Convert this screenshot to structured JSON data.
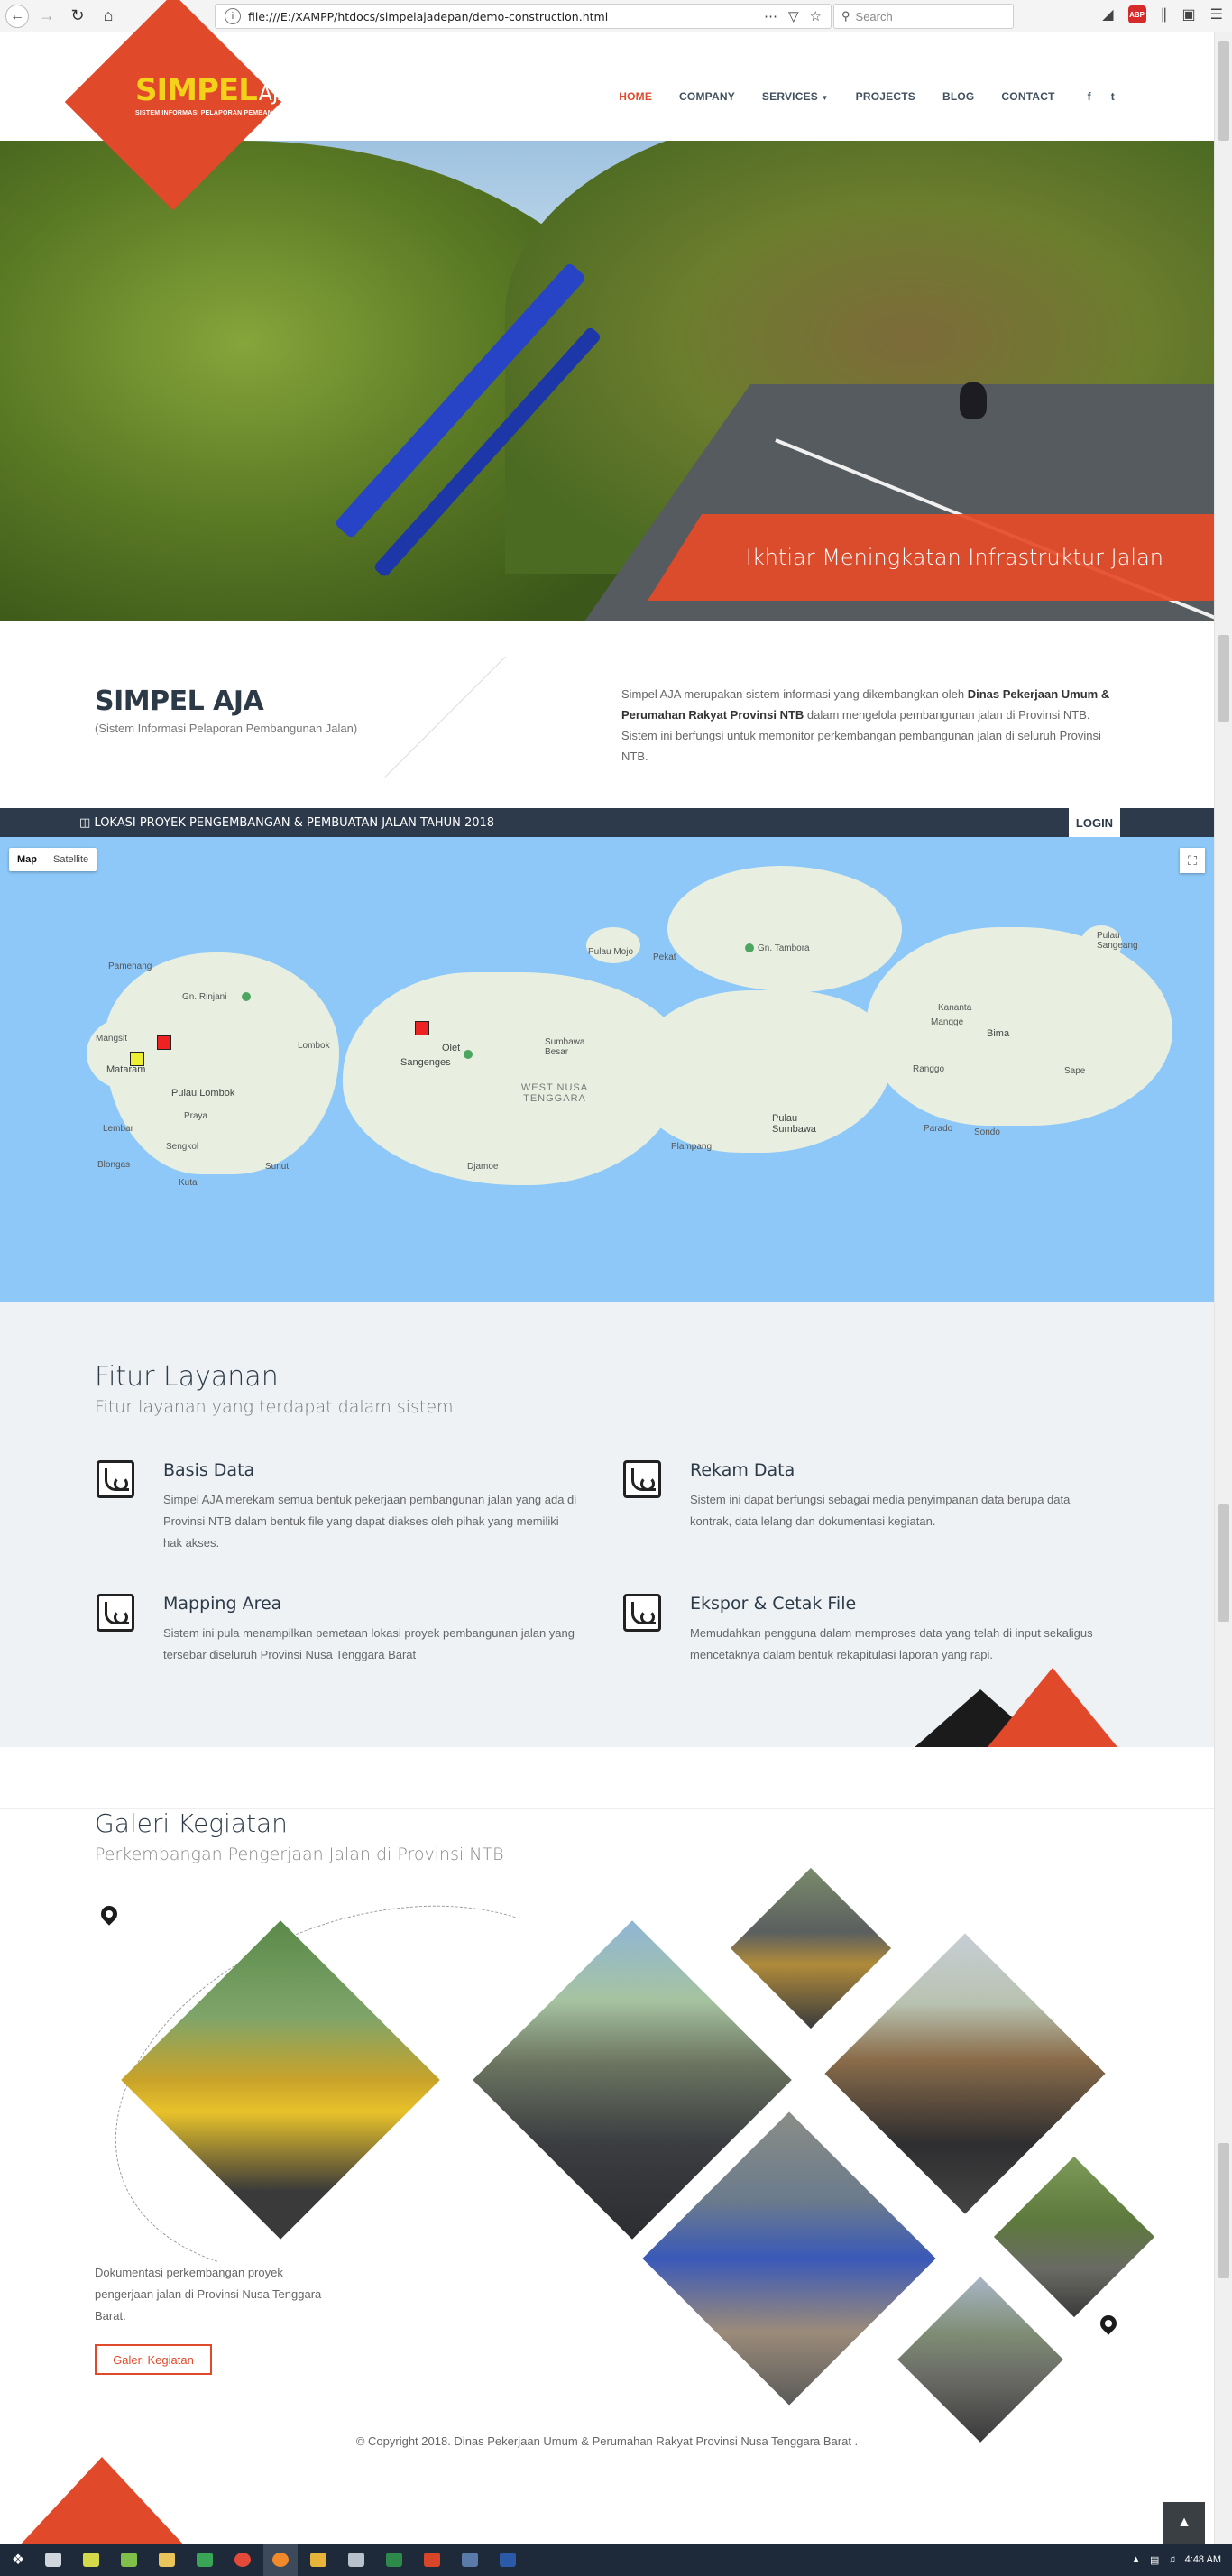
{
  "browser": {
    "url": "file:///E:/XAMPP/htdocs/simpelajadepan/demo-construction.html",
    "search_placeholder": "Search",
    "abp_label": "ABP"
  },
  "site": {
    "logo_main": "SIMPEL",
    "logo_aja": "AJA",
    "logo_sub": "SISTEM INFORMASI PELAPORAN PEMBANGUNAN JALAN",
    "nav": [
      {
        "label": "HOME"
      },
      {
        "label": "COMPANY"
      },
      {
        "label": "SERVICES"
      },
      {
        "label": "PROJECTS"
      },
      {
        "label": "BLOG"
      },
      {
        "label": "CONTACT"
      }
    ],
    "social": {
      "facebook": "f",
      "twitter": "t"
    }
  },
  "hero": {
    "caption": "Ikhtiar Meningkatan Infrastruktur Jalan"
  },
  "intro": {
    "title": "SIMPEL AJA",
    "subtitle": "(Sistem Informasi Pelaporan Pembangunan Jalan)",
    "text_before": "Simpel AJA merupakan sistem informasi yang dikembangkan oleh ",
    "text_bold": "Dinas Pekerjaan Umum & Perumahan Rakyat Provinsi NTB",
    "text_after": " dalam mengelola pembangunan jalan di Provinsi NTB. Sistem ini berfungsi untuk memonitor perkembangan pembangunan jalan di seluruh Provinsi NTB."
  },
  "map": {
    "bar_title": "LOKASI PROYEK PENGEMBANGAN & PEMBUATAN JALAN TAHUN 2018",
    "login": "LOGIN",
    "toggle_map": "Map",
    "toggle_satellite": "Satellite",
    "labels": {
      "pamenang": "Pamenang",
      "rinjani": "Gn. Rinjani",
      "mangsit": "Mangsit",
      "lombok": "Lombok",
      "mataram": "Mataram",
      "pulau_lombok": "Pulau Lombok",
      "praya": "Praya",
      "lembar": "Lembar",
      "sengkol": "Sengkol",
      "blongas": "Blongas",
      "kuta": "Kuta",
      "sunut": "Sunut",
      "olet": "Olet",
      "sangenges": "Sangenges",
      "moyo": "Pulau Mojo",
      "pekat": "Pekat",
      "tambora": "Gn. Tambora",
      "sangeang": "Pulau Sangeang",
      "sumbawa_besar": "Sumbawa Besar",
      "ntb": "WEST NUSA TENGGARA",
      "kananta": "Kananta",
      "mangge": "Mangge",
      "bima": "Bima",
      "ranggo": "Ranggo",
      "sape": "Sape",
      "pulau_sumbawa": "Pulau Sumbawa",
      "parado": "Parado",
      "sondo": "Sondo",
      "plampang": "Plampang",
      "djamoe": "Djamoe"
    }
  },
  "features": {
    "title": "Fitur Layanan",
    "subtitle": "Fitur layanan yang terdapat dalam sistem",
    "items": [
      {
        "title": "Basis Data",
        "text": "Simpel AJA merekam semua bentuk pekerjaan pembangunan jalan yang ada di Provinsi NTB dalam bentuk file yang dapat diakses oleh pihak yang memiliki hak akses."
      },
      {
        "title": "Rekam Data",
        "text": "Sistem ini dapat berfungsi sebagai media penyimpanan data berupa data kontrak, data lelang dan dokumentasi kegiatan."
      },
      {
        "title": "Mapping Area",
        "text": "Sistem ini pula menampilkan pemetaan lokasi proyek pembangunan jalan yang tersebar diseluruh Provinsi Nusa Tenggara Barat"
      },
      {
        "title": "Ekspor & Cetak File",
        "text": "Memudahkan pengguna dalam memproses data yang telah di input sekaligus mencetaknya dalam bentuk rekapitulasi laporan yang rapi."
      }
    ]
  },
  "gallery": {
    "title": "Galeri Kegiatan",
    "subtitle": "Perkembangan Pengerjaan Jalan di Provinsi NTB",
    "text": "Dokumentasi perkembangan proyek pengerjaan jalan di Provinsi Nusa Tenggara Barat.",
    "button": "Galeri Kegiatan"
  },
  "footer": {
    "copyright": "© Copyright 2018. Dinas Pekerjaan Umum & Perumahan Rakyat Provinsi Nusa Tenggara Barat ."
  },
  "taskbar": {
    "time": "4:48 AM"
  },
  "colors": {
    "accent": "#e0492a",
    "navy": "#2c3a4b",
    "logo_yellow": "#f5d21a"
  }
}
